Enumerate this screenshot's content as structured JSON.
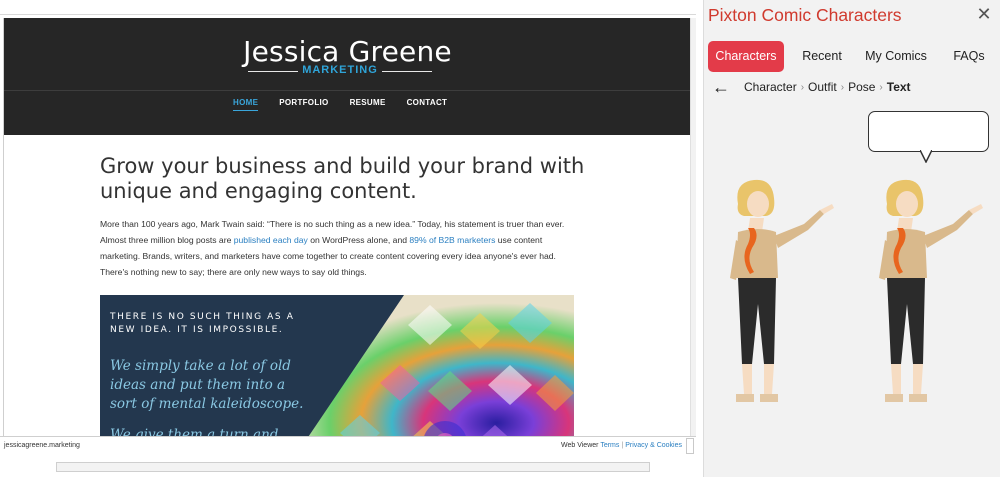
{
  "viewer": {
    "site": {
      "logo_name": "Jessica Greene",
      "logo_sub": "MARKETING",
      "nav": [
        {
          "label": "HOME",
          "active": true
        },
        {
          "label": "PORTFOLIO",
          "active": false
        },
        {
          "label": "RESUME",
          "active": false
        },
        {
          "label": "CONTACT",
          "active": false
        }
      ],
      "headline": "Grow your business and build your brand with unique and engaging content.",
      "para": {
        "p1": "More than 100 years ago, Mark Twain said: “There is no such thing as a new idea.” Today, his statement is truer than ever. Almost three million blog posts are ",
        "link1": "published each day",
        "p2": " on WordPress alone, and ",
        "link2": "89% of B2B marketers",
        "p3": " use content marketing. Brands, writers, and marketers have come together to create content covering every idea anyone's ever had. There's nothing new to say; there are only new ways to say old things."
      },
      "quote_image": {
        "small": "THERE IS NO SUCH THING AS A NEW IDEA. IT IS IMPOSSIBLE.",
        "big": "We simply take a lot of old ideas and put them into a sort of mental kaleidoscope.",
        "big_partial": "We give them a turn and"
      }
    },
    "status": {
      "url": "jessicagreene.marketing",
      "web_viewer": "Web Viewer",
      "terms": "Terms",
      "separator": "|",
      "privacy": "Privacy & Cookies"
    }
  },
  "panel": {
    "title": "Pixton Comic Characters",
    "close_icon": "close-icon",
    "tabs": [
      {
        "label": "Characters",
        "active": true
      },
      {
        "label": "Recent",
        "active": false
      },
      {
        "label": "My Comics",
        "active": false
      },
      {
        "label": "FAQs",
        "active": false
      }
    ],
    "breadcrumb": [
      "Character",
      "Outfit",
      "Pose",
      "Text"
    ],
    "breadcrumb_current": "Text",
    "back_icon": "arrow-left-icon"
  },
  "colors": {
    "pixton_red": "#d03a2e",
    "tab_active": "#e33b49",
    "site_header": "#262626",
    "site_accent": "#2fa4d8",
    "quote_bg": "#23374e"
  }
}
